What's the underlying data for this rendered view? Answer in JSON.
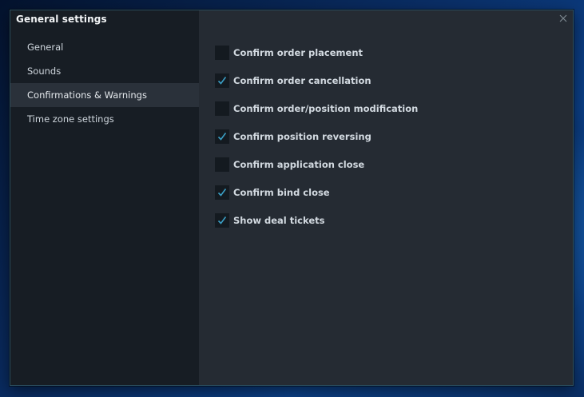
{
  "window": {
    "title": "General settings"
  },
  "sidebar": {
    "items": [
      {
        "label": "General"
      },
      {
        "label": "Sounds"
      },
      {
        "label": "Confirmations & Warnings"
      },
      {
        "label": "Time zone settings"
      }
    ],
    "active_item": "Confirmations & Warnings"
  },
  "options": [
    {
      "label": "Confirm order placement",
      "checked": false
    },
    {
      "label": "Confirm order cancellation",
      "checked": true
    },
    {
      "label": "Confirm order/position modification",
      "checked": false
    },
    {
      "label": "Confirm position reversing",
      "checked": true
    },
    {
      "label": "Confirm application close",
      "checked": false
    },
    {
      "label": "Confirm bind close",
      "checked": true
    },
    {
      "label": "Show deal tickets",
      "checked": true
    }
  ],
  "colors": {
    "accent_check": "#3a9ec4",
    "panel_bg": "#252b33",
    "sidebar_bg": "#171d24"
  },
  "icons": {
    "close": "close-icon",
    "check": "checkmark-icon"
  }
}
